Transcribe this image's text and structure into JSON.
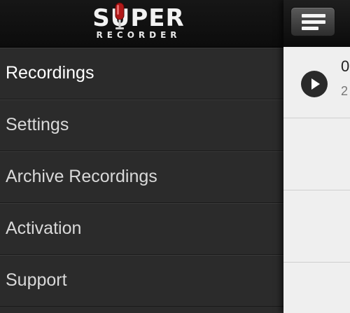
{
  "app": {
    "logo_top": "SUPER",
    "logo_bottom": "RECORDER"
  },
  "menu": {
    "items": [
      {
        "label": "Recordings",
        "active": true
      },
      {
        "label": "Settings",
        "active": false
      },
      {
        "label": "Archive Recordings",
        "active": false
      },
      {
        "label": "Activation",
        "active": false
      },
      {
        "label": "Support",
        "active": false
      }
    ]
  },
  "main": {
    "menu_button_icon": "hamburger-menu-icon",
    "first_recording": {
      "title_visible": "0",
      "subtitle_visible": "2",
      "play_icon": "play-icon"
    }
  },
  "colors": {
    "drawer_bg": "#2b2b2b",
    "header_bg": "#0c0c0c",
    "main_bg": "#efefef",
    "logo_accent": "#b01818"
  }
}
